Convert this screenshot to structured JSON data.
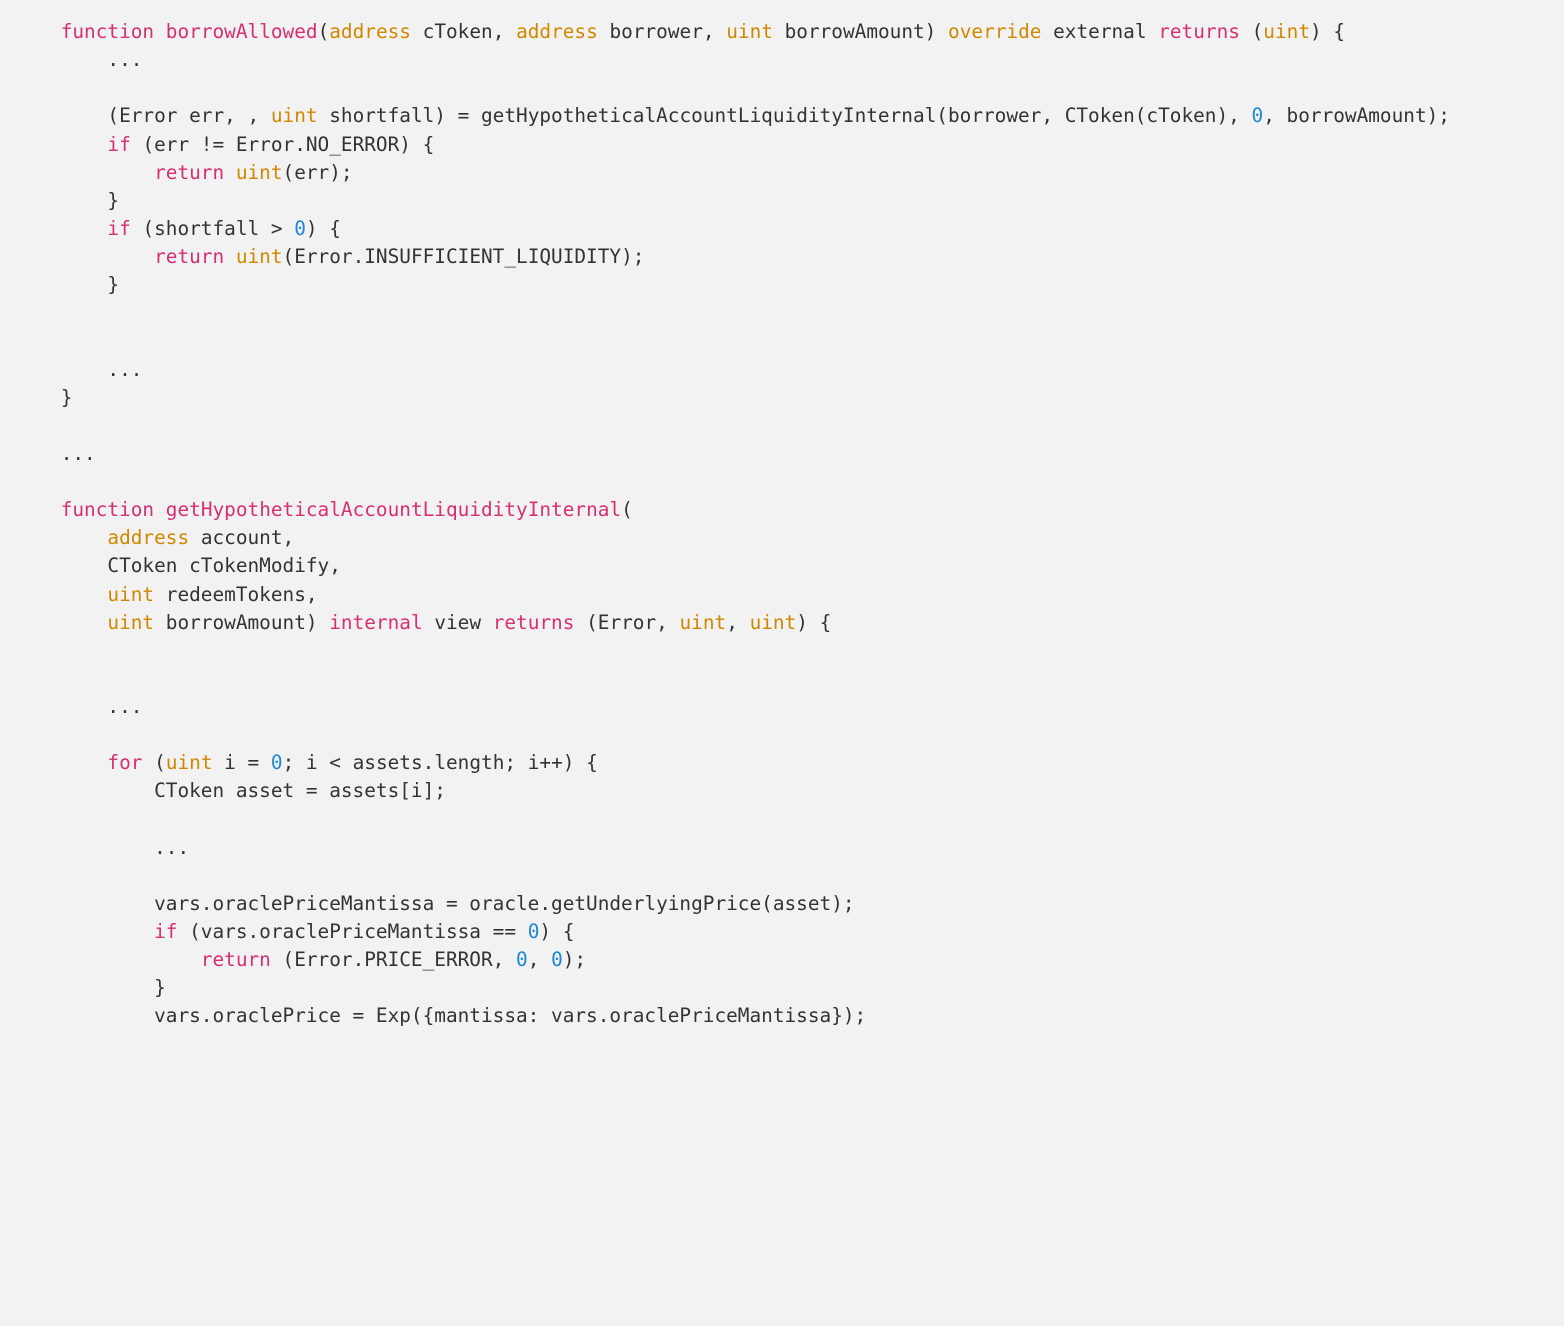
{
  "code": {
    "tokens": [
      {
        "t": "plain",
        "v": "    "
      },
      {
        "t": "kw",
        "v": "function"
      },
      {
        "t": "plain",
        "v": " "
      },
      {
        "t": "fn",
        "v": "borrowAllowed"
      },
      {
        "t": "plain",
        "v": "("
      },
      {
        "t": "type",
        "v": "address"
      },
      {
        "t": "plain",
        "v": " cToken, "
      },
      {
        "t": "type",
        "v": "address"
      },
      {
        "t": "plain",
        "v": " borrower, "
      },
      {
        "t": "type",
        "v": "uint"
      },
      {
        "t": "plain",
        "v": " borrowAmount) "
      },
      {
        "t": "mod",
        "v": "override"
      },
      {
        "t": "plain",
        "v": " external "
      },
      {
        "t": "kw",
        "v": "returns"
      },
      {
        "t": "plain",
        "v": " ("
      },
      {
        "t": "type",
        "v": "uint"
      },
      {
        "t": "plain",
        "v": ") {\n"
      },
      {
        "t": "plain",
        "v": "        ...\n\n"
      },
      {
        "t": "plain",
        "v": "        (Error err, , "
      },
      {
        "t": "type",
        "v": "uint"
      },
      {
        "t": "plain",
        "v": " shortfall) = getHypotheticalAccountLiquidityInternal(borrower, CToken(cToken), "
      },
      {
        "t": "num",
        "v": "0"
      },
      {
        "t": "plain",
        "v": ", borrowAmount);\n"
      },
      {
        "t": "plain",
        "v": "        "
      },
      {
        "t": "kw",
        "v": "if"
      },
      {
        "t": "plain",
        "v": " (err != Error.NO_ERROR) {\n"
      },
      {
        "t": "plain",
        "v": "            "
      },
      {
        "t": "kw",
        "v": "return"
      },
      {
        "t": "plain",
        "v": " "
      },
      {
        "t": "type",
        "v": "uint"
      },
      {
        "t": "plain",
        "v": "(err);\n"
      },
      {
        "t": "plain",
        "v": "        }\n"
      },
      {
        "t": "plain",
        "v": "        "
      },
      {
        "t": "kw",
        "v": "if"
      },
      {
        "t": "plain",
        "v": " (shortfall > "
      },
      {
        "t": "num",
        "v": "0"
      },
      {
        "t": "plain",
        "v": ") {\n"
      },
      {
        "t": "plain",
        "v": "            "
      },
      {
        "t": "kw",
        "v": "return"
      },
      {
        "t": "plain",
        "v": " "
      },
      {
        "t": "type",
        "v": "uint"
      },
      {
        "t": "plain",
        "v": "(Error.INSUFFICIENT_LIQUIDITY);\n"
      },
      {
        "t": "plain",
        "v": "        }\n\n\n"
      },
      {
        "t": "plain",
        "v": "        ...\n"
      },
      {
        "t": "plain",
        "v": "    }\n\n"
      },
      {
        "t": "plain",
        "v": "    ...\n\n"
      },
      {
        "t": "plain",
        "v": "    "
      },
      {
        "t": "kw",
        "v": "function"
      },
      {
        "t": "plain",
        "v": " "
      },
      {
        "t": "fn",
        "v": "getHypotheticalAccountLiquidityInternal"
      },
      {
        "t": "plain",
        "v": "(\n"
      },
      {
        "t": "plain",
        "v": "        "
      },
      {
        "t": "type",
        "v": "address"
      },
      {
        "t": "plain",
        "v": " account,\n"
      },
      {
        "t": "plain",
        "v": "        CToken cTokenModify,\n"
      },
      {
        "t": "plain",
        "v": "        "
      },
      {
        "t": "type",
        "v": "uint"
      },
      {
        "t": "plain",
        "v": " redeemTokens,\n"
      },
      {
        "t": "plain",
        "v": "        "
      },
      {
        "t": "type",
        "v": "uint"
      },
      {
        "t": "plain",
        "v": " borrowAmount) "
      },
      {
        "t": "kw",
        "v": "internal"
      },
      {
        "t": "plain",
        "v": " view "
      },
      {
        "t": "kw",
        "v": "returns"
      },
      {
        "t": "plain",
        "v": " (Error, "
      },
      {
        "t": "type",
        "v": "uint"
      },
      {
        "t": "plain",
        "v": ", "
      },
      {
        "t": "type",
        "v": "uint"
      },
      {
        "t": "plain",
        "v": ") {\n\n\n"
      },
      {
        "t": "plain",
        "v": "        ...\n\n"
      },
      {
        "t": "plain",
        "v": "        "
      },
      {
        "t": "kw",
        "v": "for"
      },
      {
        "t": "plain",
        "v": " ("
      },
      {
        "t": "type",
        "v": "uint"
      },
      {
        "t": "plain",
        "v": " i = "
      },
      {
        "t": "num",
        "v": "0"
      },
      {
        "t": "plain",
        "v": "; i < assets.length; i++) {\n"
      },
      {
        "t": "plain",
        "v": "            CToken asset = assets[i];\n\n"
      },
      {
        "t": "plain",
        "v": "            ...\n\n"
      },
      {
        "t": "plain",
        "v": "            vars.oraclePriceMantissa = oracle.getUnderlyingPrice(asset);\n"
      },
      {
        "t": "plain",
        "v": "            "
      },
      {
        "t": "kw",
        "v": "if"
      },
      {
        "t": "plain",
        "v": " (vars.oraclePriceMantissa == "
      },
      {
        "t": "num",
        "v": "0"
      },
      {
        "t": "plain",
        "v": ") {\n"
      },
      {
        "t": "plain",
        "v": "                "
      },
      {
        "t": "kw",
        "v": "return"
      },
      {
        "t": "plain",
        "v": " (Error.PRICE_ERROR, "
      },
      {
        "t": "num",
        "v": "0"
      },
      {
        "t": "plain",
        "v": ", "
      },
      {
        "t": "num",
        "v": "0"
      },
      {
        "t": "plain",
        "v": ");\n"
      },
      {
        "t": "plain",
        "v": "            }\n"
      },
      {
        "t": "plain",
        "v": "            vars.oraclePrice = Exp({mantissa: vars.oraclePriceMantissa});\n"
      }
    ]
  }
}
